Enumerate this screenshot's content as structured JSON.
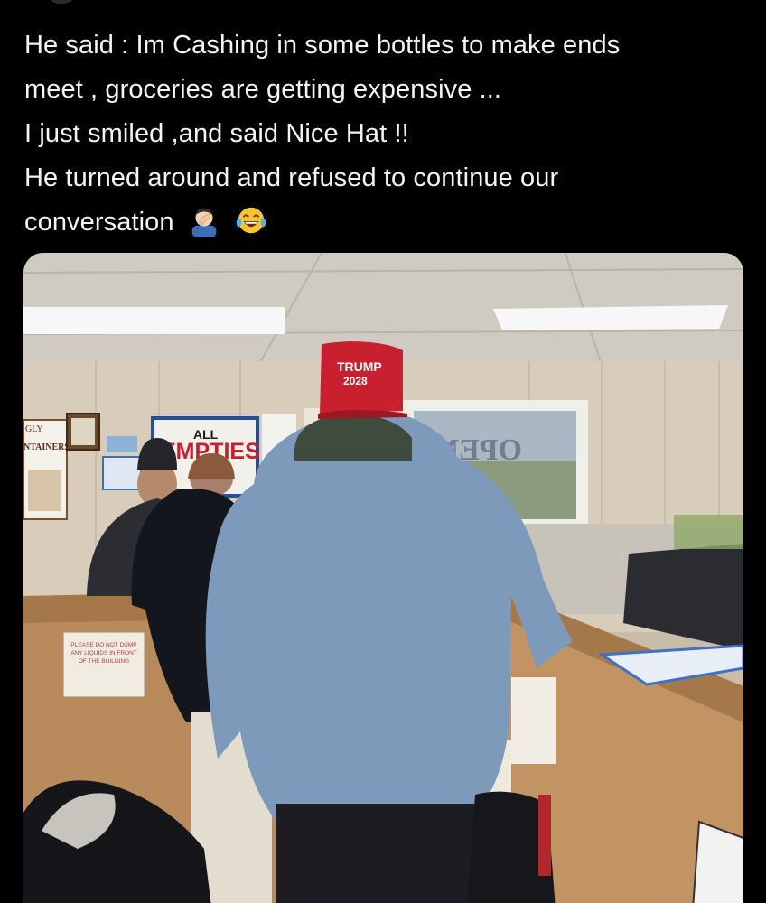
{
  "post": {
    "lines": [
      "He said : Im Cashing in some bottles to make ends",
      "meet , groceries are getting expensive ...",
      "I just smiled ,and said Nice Hat !!",
      "He turned around and refused to continue our",
      "conversation"
    ],
    "emojis": [
      "man-facepalming-icon",
      "face-with-tears-of-joy-icon"
    ]
  },
  "photo": {
    "signs": {
      "left_sign_top": "GLY",
      "left_sign_mid": "NTAINERS",
      "empties_all": "ALL",
      "empties_main": "EMPTIES",
      "open_sign": "OPEN",
      "hat_brand": "TRUMP",
      "hat_year": "2028",
      "counter_notice": "PLEASE DO NOT DUMP ANY LIQUIDS IN FRONT OF THE BUILDING"
    },
    "colors": {
      "hat": "#c8202e",
      "jacket": "#7b98b8",
      "wall": "#d8cdbb",
      "counter": "#b98b5c"
    }
  }
}
